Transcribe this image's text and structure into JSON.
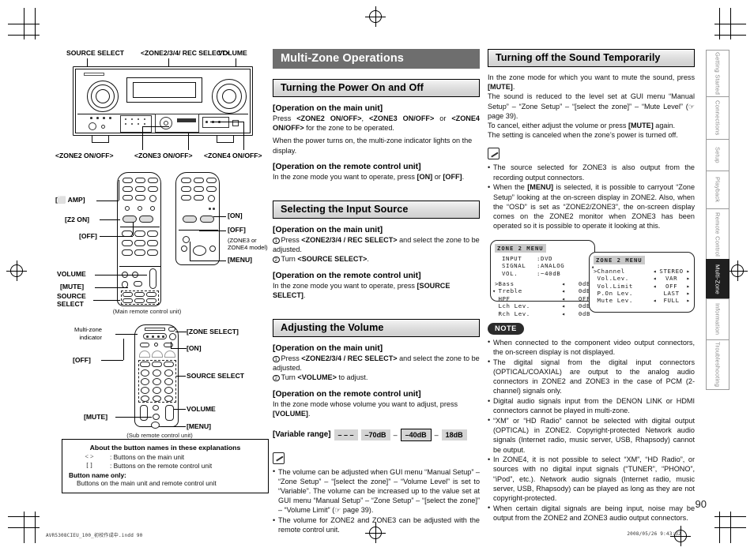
{
  "page_number": "90",
  "footer": {
    "left": "AVR5308CIEU_100_初校作成中.indd   90",
    "right": "2008/05/26   9:43:32"
  },
  "tabs": [
    {
      "label": "Getting Started",
      "active": false
    },
    {
      "label": "Connections",
      "active": false
    },
    {
      "label": "Setup",
      "active": false
    },
    {
      "label": "Playback",
      "active": false
    },
    {
      "label": "Remote Control",
      "active": false
    },
    {
      "label": "Multi-Zone",
      "active": true
    },
    {
      "label": "Information",
      "active": false
    },
    {
      "label": "Troubleshooting",
      "active": false
    }
  ],
  "figures": {
    "main_unit": {
      "labels": {
        "source_select": "SOURCE SELECT",
        "zone_rec_select": "<ZONE2/3/4/ REC SELECT>",
        "volume": "VOLUME",
        "zone2_onoff": "<ZONE2 ON/OFF>",
        "zone3_onoff": "<ZONE3 ON/OFF>",
        "zone4_onoff": "<ZONE4 ON/OFF>"
      }
    },
    "main_remote": {
      "caption": "(Main remote control unit)",
      "labels": {
        "amp": "[⬜ AMP]",
        "z2_on": "[Z2 ON]",
        "off_left": "[OFF]",
        "volume": "VOLUME",
        "mute": "[MUTE]",
        "source_select": "SOURCE\nSELECT",
        "on_right": "[ON]",
        "off_right": "[OFF]",
        "zone_model": "(ZONE3 or\nZONE4 model)",
        "menu": "[MENU]"
      }
    },
    "sub_remote": {
      "caption": "(Sub remote control unit)",
      "labels": {
        "multizone_indicator": "Multi-zone\nindicator",
        "off": "[OFF]",
        "zone_select": "[ZONE SELECT]",
        "on": "[ON]",
        "source_select": "SOURCE SELECT",
        "volume": "VOLUME",
        "mute": "[MUTE]",
        "menu": "[MENU]"
      }
    }
  },
  "legend": {
    "title": "About the button names in these explanations",
    "rows": [
      {
        "key": "<    >",
        "desc": ": Buttons on the main unit"
      },
      {
        "key": "[    ]",
        "desc": ": Buttons on the remote control unit"
      }
    ],
    "button_name_only_title": "Button name only:",
    "button_name_only_desc": "Buttons on the main unit and remote control unit"
  },
  "middle": {
    "chapter_title": "Multi-Zone Operations",
    "sections": [
      {
        "title": "Turning the Power On and Off",
        "blocks": [
          {
            "heading": "[Operation on the main unit]",
            "lines": [
              "Press <ZONE2 ON/OFF>, <ZONE3 ON/OFF> or <ZONE4 ON/OFF> for the zone to be operated.",
              "When the power turns on, the multi-zone indicator lights on the display."
            ]
          },
          {
            "heading": "[Operation on the remote control unit]",
            "lines": [
              "In the zone mode you want to operate, press [ON] or [OFF]."
            ]
          }
        ]
      },
      {
        "title": "Selecting the Input Source",
        "blocks": [
          {
            "heading": "[Operation on the main unit]",
            "steps": [
              "Press <ZONE2/3/4 / REC SELECT> and select the zone to be adjusted.",
              "Turn <SOURCE SELECT>."
            ]
          },
          {
            "heading": "[Operation on the remote control unit]",
            "lines": [
              "In the zone mode you want to operate, press [SOURCE SELECT]."
            ]
          }
        ]
      },
      {
        "title": "Adjusting the Volume",
        "blocks": [
          {
            "heading": "[Operation on the main unit]",
            "steps": [
              "Press <ZONE2/3/4 / REC SELECT> and select the zone to be adjusted.",
              "Turn <VOLUME> to adjust."
            ]
          },
          {
            "heading": "[Operation on the remote control unit]",
            "lines": [
              "In the zone mode whose volume you want to adjust, press [VOLUME]."
            ]
          }
        ]
      }
    ],
    "variable_range": {
      "label": "[Variable range]",
      "items": [
        "– – –",
        "–70dB",
        "–40dB",
        "18dB"
      ],
      "selected": "–40dB",
      "separator": "–"
    },
    "memo": [
      "The volume can be adjusted when GUI menu “Manual Setup” – “Zone Setup” – “[select the zone]” – “Volume Level” is set to “Variable”. The volume can be increased up to the value set at GUI menu “Manual Setup” – “Zone Setup” – “[select the zone]” – “Volume Limit” (☞ page 39).",
      "The volume for ZONE2 and ZONE3 can be adjusted with the remote control unit."
    ]
  },
  "right": {
    "section_title": "Turning off the Sound Temporarily",
    "paragraphs": [
      "In the zone mode for which you want to mute the sound, press [MUTE].",
      "The sound is reduced to the level set at GUI menu “Manual Setup” – “Zone Setup” – “[select the zone]” – “Mute Level” (☞ page 39).",
      "To cancel, either adjust the volume or press [MUTE] again.",
      "The setting is canceled when the zone’s power is turned off."
    ],
    "memo": [
      "The source selected for ZONE3 is also output from the recording output connectors.",
      "When the [MENU] is selected, it is possible to carryout “Zone Setup” looking at the on-screen display in ZONE2. Also, when the “OSD” is set as “ZONE2/ZONE3”, the on-screen display comes on the ZONE2 monitor when ZONE3 has been operated so it is possible to operate it looking at this."
    ],
    "osd": {
      "screen1": {
        "title": "ZONE 2  MENU",
        "info": [
          {
            "k": "INPUT",
            "v": ":DVD"
          },
          {
            "k": "SIGNAL",
            "v": ":ANALOG"
          },
          {
            "k": "VOL.",
            "v": ":−40dB"
          }
        ],
        "items": [
          {
            "cursor": true,
            "k": "Bass",
            "arrow": "◂",
            "v": "0dB"
          },
          {
            "cursor": false,
            "k": "Treble",
            "arrow": "◂",
            "v": "0dB"
          },
          {
            "cursor": false,
            "k": "HPF",
            "arrow": "◂",
            "v": "OFF"
          },
          {
            "cursor": false,
            "k": "Lch Lev.",
            "arrow": "◂",
            "v": "0dB"
          },
          {
            "cursor": false,
            "k": "Rch Lev.",
            "arrow": "◂",
            "v": "0dB"
          }
        ]
      },
      "screen2": {
        "title": "ZONE 2  MENU",
        "items": [
          {
            "cursor": true,
            "k": "Channel",
            "l": "◂",
            "v": "STEREO",
            "r": "▸"
          },
          {
            "cursor": false,
            "k": "Vol.Lev.",
            "l": "◂",
            "v": "VAR",
            "r": "▸"
          },
          {
            "cursor": false,
            "k": "Vol.Limit",
            "l": "◂",
            "v": "OFF",
            "r": "▸"
          },
          {
            "cursor": false,
            "k": "P.On Lev.",
            "l": "",
            "v": "LAST",
            "r": "▸"
          },
          {
            "cursor": false,
            "k": "Mute Lev.",
            "l": "◂",
            "v": "FULL",
            "r": "▸"
          }
        ]
      }
    },
    "note_badge": "NOTE",
    "notes": [
      "When connected to the component video output connectors, the on-screen display is not displayed.",
      "The digital signal from the digital input connectors (OPTICAL/COAXIAL) are output to the analog audio connectors in ZONE2 and ZONE3 in the case of PCM (2-channel) signals only.",
      "Digital audio signals input from the DENON LINK or HDMI connectors cannot be played in multi-zone.",
      "“XM” or “HD Radio” cannot be selected with digital output (OPTICAL) in ZONE2. Copyright-protected Network audio signals (Internet radio, music server, USB, Rhapsody) cannot be output.",
      "In ZONE4, it is not possible to select “XM”, “HD Radio”, or sources with no digital input signals (“TUNER”, “PHONO”, “iPod”, etc.). Network audio signals (Internet radio, music server, USB, Rhapsody) can be played as long as they are not copyright-protected.",
      "When certain digital signals are being input, noise may be output from the ZONE2 and ZONE3 audio output connectors."
    ]
  }
}
